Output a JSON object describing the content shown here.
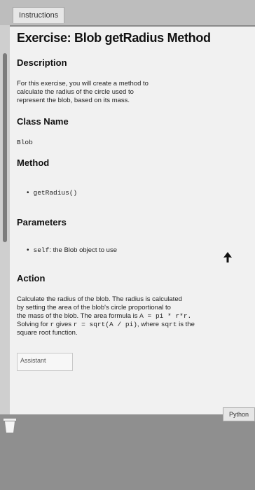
{
  "tab": {
    "label": "Instructions"
  },
  "exercise": {
    "title": "Exercise: Blob getRadius Method",
    "description_heading": "Description",
    "description_lines": [
      "For this exercise, you will create a method to",
      "calculate the radius of the circle used to",
      "represent the blob, based on its mass."
    ],
    "class_heading": "Class Name",
    "class_name": "Blob",
    "method_heading": "Method",
    "method_name": "getRadius()",
    "parameters_heading": "Parameters",
    "param_name": "self",
    "param_desc": ": the Blob object to use",
    "action_heading": "Action",
    "action_lines": {
      "l1": "Calculate the radius of the blob. The radius is calculated",
      "l2": "by setting the area of the blob's circle proportional to",
      "l3_text": "the mass of the blob. The area formula is ",
      "l3_code": "A = pi * r*r.",
      "l4_pre": "Solving for ",
      "l4_r": "r",
      "l4_mid": " gives ",
      "l4_code": "r = sqrt(A / pi)",
      "l4_post": ", where ",
      "l4_sqrt": "sqrt",
      "l4_end": " is the",
      "l5": "square root function."
    }
  },
  "assistant": {
    "label": "Assistant"
  },
  "language_button": {
    "label": "Python"
  },
  "icons": {
    "trash": "trash-icon",
    "cursor": "mouse-cursor-icon"
  }
}
